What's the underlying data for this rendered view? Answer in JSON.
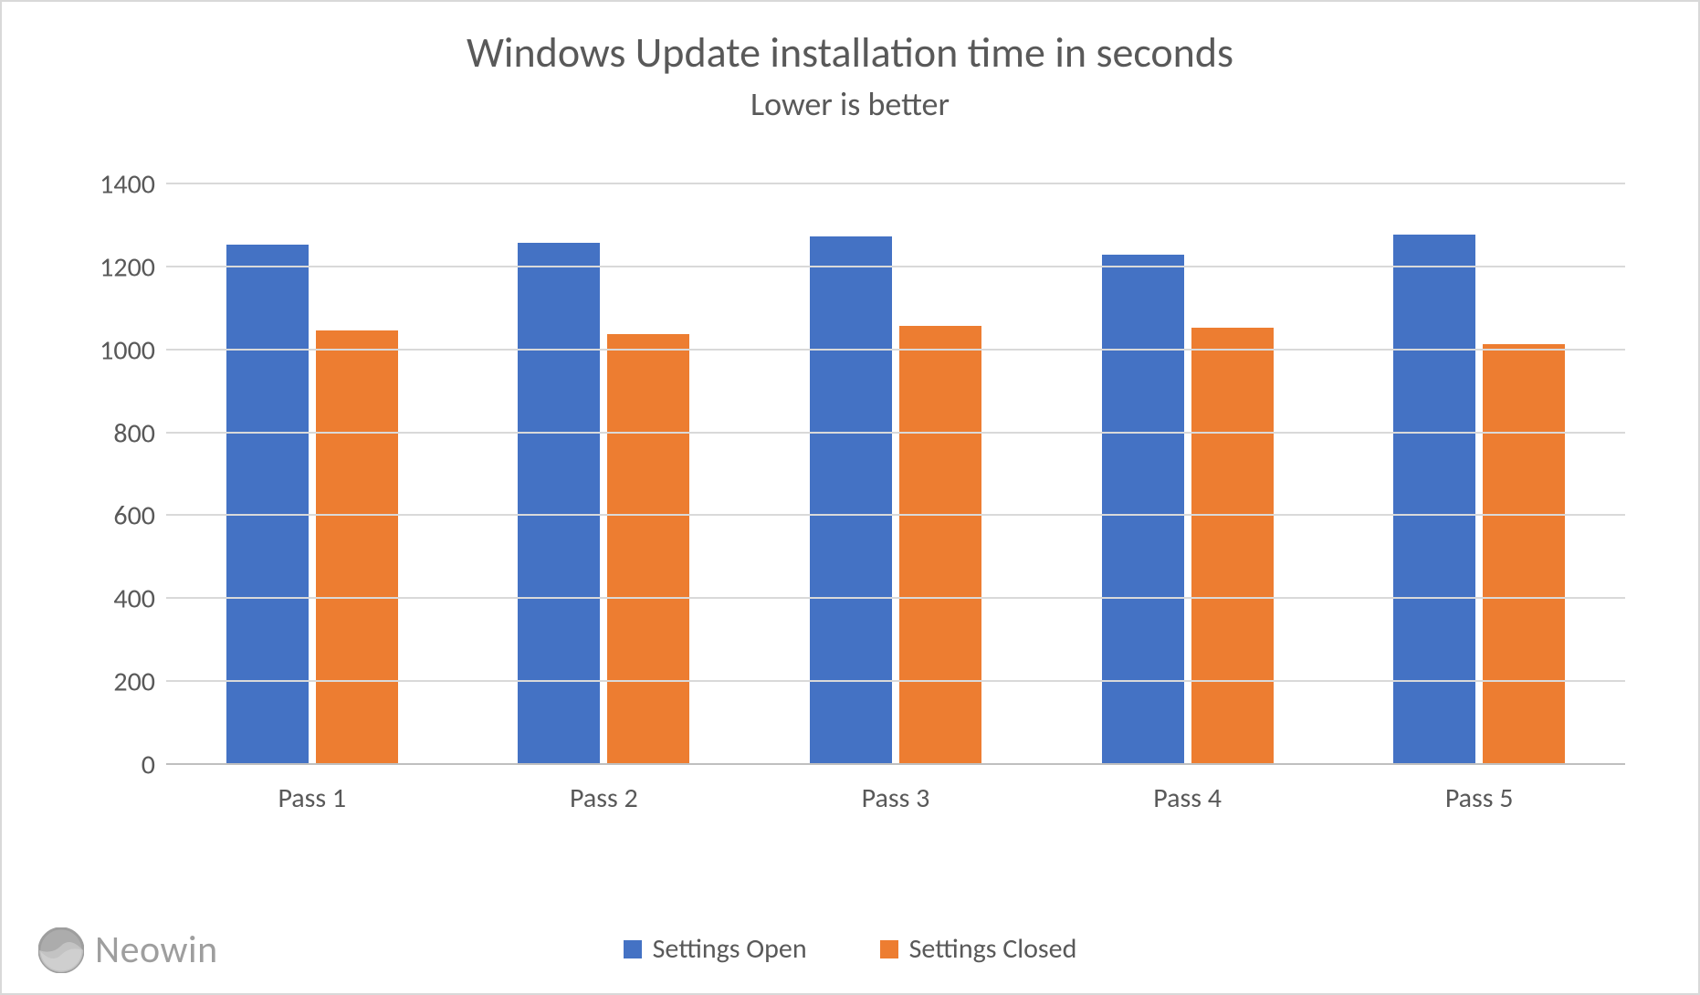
{
  "title": "Windows Update installation time in seconds",
  "subtitle": "Lower is better",
  "legend": {
    "series_a": "Settings Open",
    "series_b": "Settings Closed"
  },
  "watermark": "Neowin",
  "chart_data": {
    "type": "bar",
    "title": "Windows Update installation time in seconds",
    "subtitle": "Lower is better",
    "xlabel": "",
    "ylabel": "",
    "ylim": [
      0,
      1400
    ],
    "yticks": [
      0,
      200,
      400,
      600,
      800,
      1000,
      1200,
      1400
    ],
    "categories": [
      "Pass 1",
      "Pass 2",
      "Pass 3",
      "Pass 4",
      "Pass 5"
    ],
    "series": [
      {
        "name": "Settings Open",
        "color": "#4472c4",
        "values": [
          1255,
          1260,
          1275,
          1230,
          1280
        ]
      },
      {
        "name": "Settings Closed",
        "color": "#ed7d31",
        "values": [
          1048,
          1038,
          1058,
          1054,
          1015
        ]
      }
    ],
    "legend_position": "bottom",
    "grid": {
      "y": true,
      "x": false
    }
  }
}
